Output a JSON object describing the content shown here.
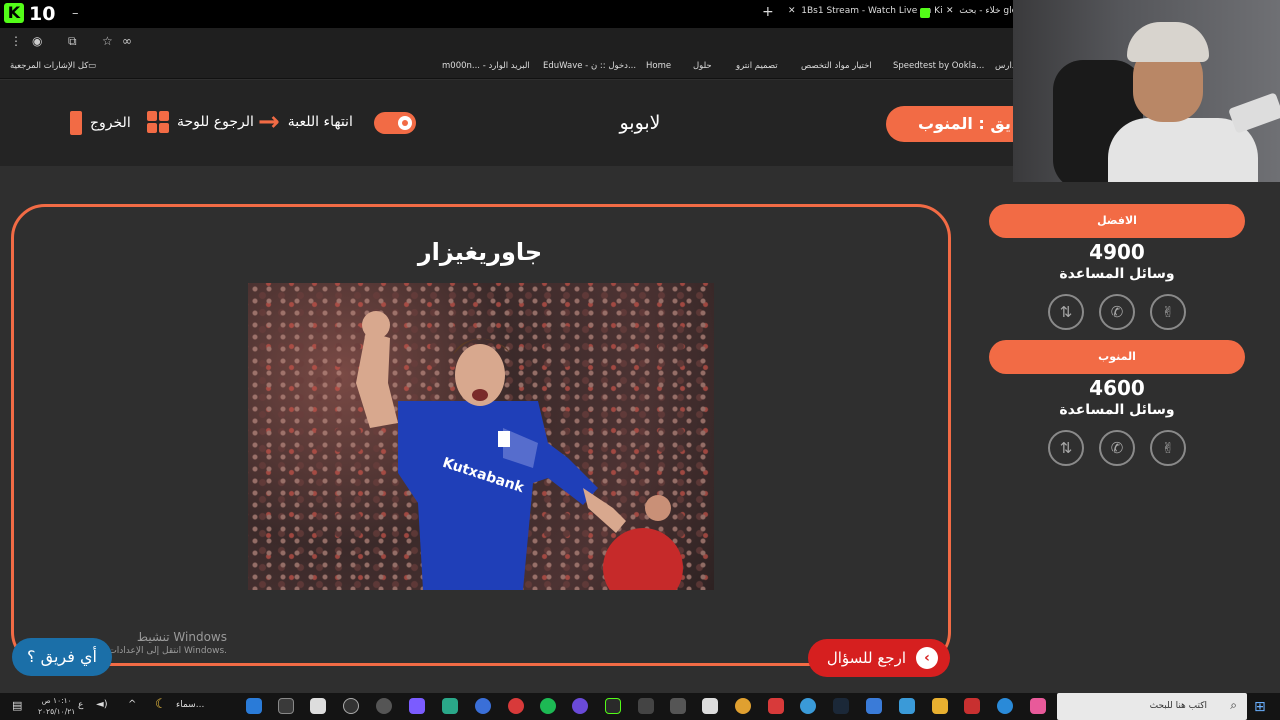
{
  "browser": {
    "viewer_count": "10",
    "tabs": [
      "1Bs1 Stream - Watch Live on Ki",
      "خلاء - بحث gle"
    ],
    "bookmarks": [
      "كل الإشارات المرجعية",
      "m000n... - البريد الوارد",
      "EduWave - دخول :: ن...",
      "Home",
      "حلول",
      "تصميم انترو",
      "اختيار مواد التخصص",
      "Speedtest by Ookla...",
      "دارس"
    ]
  },
  "header": {
    "exit_label": "الخروج",
    "board_label": "الرجوع للوحة",
    "end_game_label": "انتهاء اللعبة",
    "game_title": "لابوبو",
    "turn_label": "يق : المنوب"
  },
  "question": {
    "answer": "جاوريغيزار",
    "back_label": "ارجع للسؤال",
    "which_team_label": "أي فريق ؟"
  },
  "windows_notice": {
    "title": "تنشيط Windows",
    "subtitle": "انتقل إلى الإعدادات لتنشيط Windows."
  },
  "teams": [
    {
      "name": "الافضل",
      "score": "4900",
      "lifelines_label": "وسائل المساعدة"
    },
    {
      "name": "المنوب",
      "score": "4600",
      "lifelines_label": "وسائل المساعدة"
    }
  ],
  "lifeline_icons": [
    "swap-icon",
    "phone-icon",
    "peace-hand-icon"
  ],
  "taskbar": {
    "time": "١٠:١٠ ص",
    "date": "٢٠٢٥/١٠/٢١",
    "weather": "سماء...",
    "search_placeholder": "اكتب هنا للبحث"
  },
  "colors": {
    "accent": "#f26b45",
    "back_button": "#d61f1f",
    "team_button": "#1b6fa8",
    "background": "#2f2f2f"
  }
}
